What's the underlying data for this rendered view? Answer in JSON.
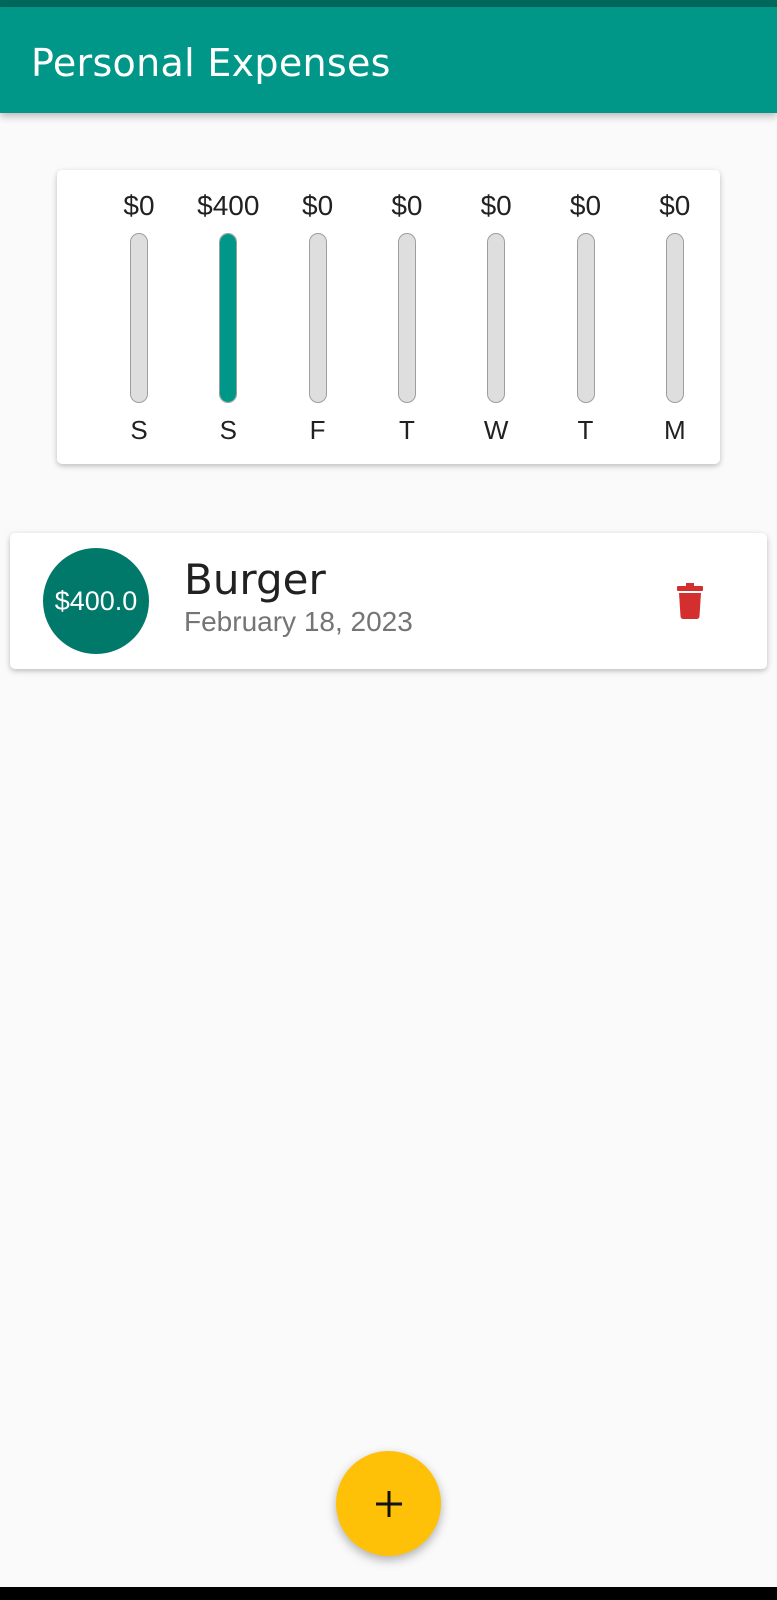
{
  "app": {
    "title": "Personal Expenses"
  },
  "chart_data": {
    "type": "bar",
    "categories": [
      "S",
      "S",
      "F",
      "T",
      "W",
      "T",
      "M"
    ],
    "value_labels": [
      "$0",
      "$400",
      "$0",
      "$0",
      "$0",
      "$0",
      "$0"
    ],
    "values": [
      0,
      400,
      0,
      0,
      0,
      0,
      0
    ],
    "fill_fraction": [
      0,
      1,
      0,
      0,
      0,
      0,
      0
    ],
    "colors": {
      "fill": "#009688",
      "track": "#dedede"
    }
  },
  "transactions": [
    {
      "amount": "$400.0",
      "title": "Burger",
      "date": "February 18, 2023",
      "delete_icon": "trash-icon"
    }
  ],
  "fab": {
    "icon": "plus-icon"
  },
  "colors": {
    "primary": "#009688",
    "accent": "#ffc107",
    "delete": "#d32f2f"
  }
}
